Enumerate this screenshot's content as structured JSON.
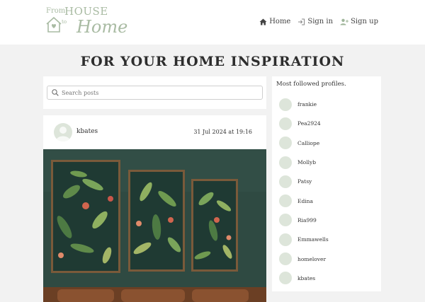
{
  "brand": {
    "from": "From",
    "house": "HOUSE",
    "to": "to",
    "home": "Home",
    "color": "#a9bba3"
  },
  "nav": {
    "items": [
      {
        "label": "Home",
        "icon": "home-icon"
      },
      {
        "label": "Sign in",
        "icon": "sign-in-icon"
      },
      {
        "label": "Sign up",
        "icon": "user-plus-icon"
      }
    ]
  },
  "page": {
    "heading": "FOR YOUR HOME INSPIRATION"
  },
  "search": {
    "placeholder": "Search posts",
    "icon": "search-icon"
  },
  "post": {
    "username": "kbates",
    "date": "31 Jul 2024 at 19:16",
    "image_description_icon": "framed-botanical-prints-image"
  },
  "profiles": {
    "title": "Most followed profiles.",
    "items": [
      "frankie",
      "Pea2924",
      "Calliope",
      "Mollyb",
      "Patsy",
      "Edina",
      "Ria999",
      "Emmawells",
      "homelover",
      "kbates"
    ]
  },
  "colors": {
    "accent": "#a9bba3",
    "avatar_bg": "#dde5da",
    "page_bg": "#f2f2f2"
  }
}
